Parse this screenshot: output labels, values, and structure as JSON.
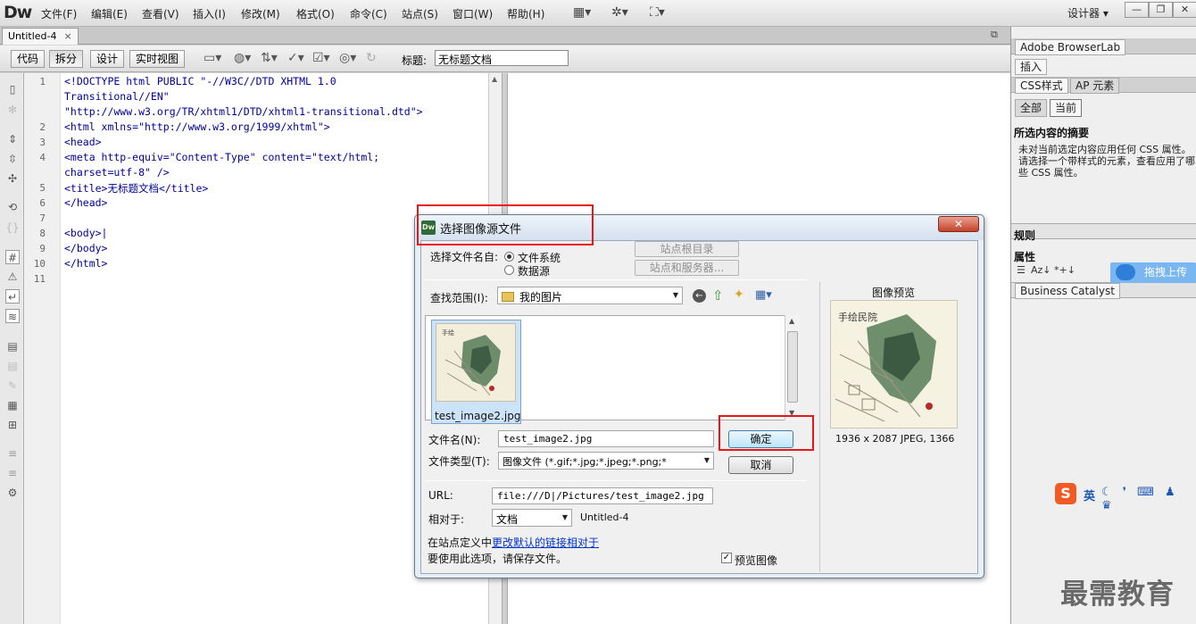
{
  "app": {
    "logo": "Dw",
    "workspace": "设计器 ▾"
  },
  "menu": [
    "文件(F)",
    "编辑(E)",
    "查看(V)",
    "插入(I)",
    "修改(M)",
    "格式(O)",
    "命令(C)",
    "站点(S)",
    "窗口(W)",
    "帮助(H)"
  ],
  "toolbar_icons": [
    "layout-icon",
    "gear-icon",
    "site-icon"
  ],
  "window_buttons": [
    "—",
    "❐",
    "✕"
  ],
  "document_tab": {
    "label": "Untitled-4",
    "close": "×"
  },
  "view_buttons": {
    "code": "代码",
    "split": "拆分",
    "design": "设计",
    "live": "实时视图"
  },
  "title_label": "标题:",
  "title_value": "无标题文档",
  "code_lines": [
    {
      "n": "1",
      "t": "<!DOCTYPE html PUBLIC \"-//W3C//DTD XHTML 1.0"
    },
    {
      "n": "",
      "t": "Transitional//EN\""
    },
    {
      "n": "",
      "t": "\"http://www.w3.org/TR/xhtml1/DTD/xhtml1-transitional.dtd\">"
    },
    {
      "n": "2",
      "t": "<html xmlns=\"http://www.w3.org/1999/xhtml\">"
    },
    {
      "n": "3",
      "t": "<head>"
    },
    {
      "n": "4",
      "t": "<meta http-equiv=\"Content-Type\" content=\"text/html;"
    },
    {
      "n": "",
      "t": "charset=utf-8\" />"
    },
    {
      "n": "5",
      "t": "<title>无标题文档</title>"
    },
    {
      "n": "6",
      "t": "</head>"
    },
    {
      "n": "7",
      "t": ""
    },
    {
      "n": "8",
      "t": "<body>|"
    },
    {
      "n": "9",
      "t": "</body>"
    },
    {
      "n": "10",
      "t": "</html>"
    },
    {
      "n": "11",
      "t": ""
    }
  ],
  "right_panel": {
    "browserlab": "Adobe BrowserLab",
    "insert": "插入",
    "css_tab": "CSS样式",
    "ap_tab": "AP 元素",
    "all": "全部",
    "current": "当前",
    "summary_title": "所选内容的摘要",
    "summary_text": "未对当前选定内容应用任何 CSS 属性。请选择一个带样式的元素，查看应用了哪些 CSS 属性。",
    "rules": "规则",
    "properties": "属性",
    "business_catalyst": "Business Catalyst",
    "upload_badge": "拖拽上传"
  },
  "dialog": {
    "icon": "Dw",
    "title": "选择图像源文件",
    "close": "✕",
    "select_from_label": "选择文件名自:",
    "radio_filesystem": "文件系统",
    "radio_datasource": "数据源",
    "site_root_btn": "站点根目录",
    "site_server_btn": "站点和服务器...",
    "lookin_label": "查找范围(I):",
    "lookin_value": "我的图片",
    "file_item": "test_image2.jpg",
    "filename_label": "文件名(N):",
    "filename_value": "test_image2.jpg",
    "filetype_label": "文件类型(T):",
    "filetype_value": "图像文件 (*.gif;*.jpg;*.jpeg;*.png;*",
    "ok": "确定",
    "cancel": "取消",
    "url_label": "URL:",
    "url_value": "file:///D|/Pictures/test_image2.jpg",
    "relative_label": "相对于:",
    "relative_value": "文档",
    "relative_doc": "Untitled-4",
    "note_prefix": "在站点定义中",
    "note_link": "更改默认的链接相对于",
    "note_line2": "要使用此选项，请保存文件。",
    "preview_check": "预览图像",
    "preview_title": "图像预览",
    "preview_info": "1936 x 2087 JPEG, 1366"
  },
  "ime": {
    "s": "S",
    "lang": "英"
  },
  "watermark": "最需教育"
}
